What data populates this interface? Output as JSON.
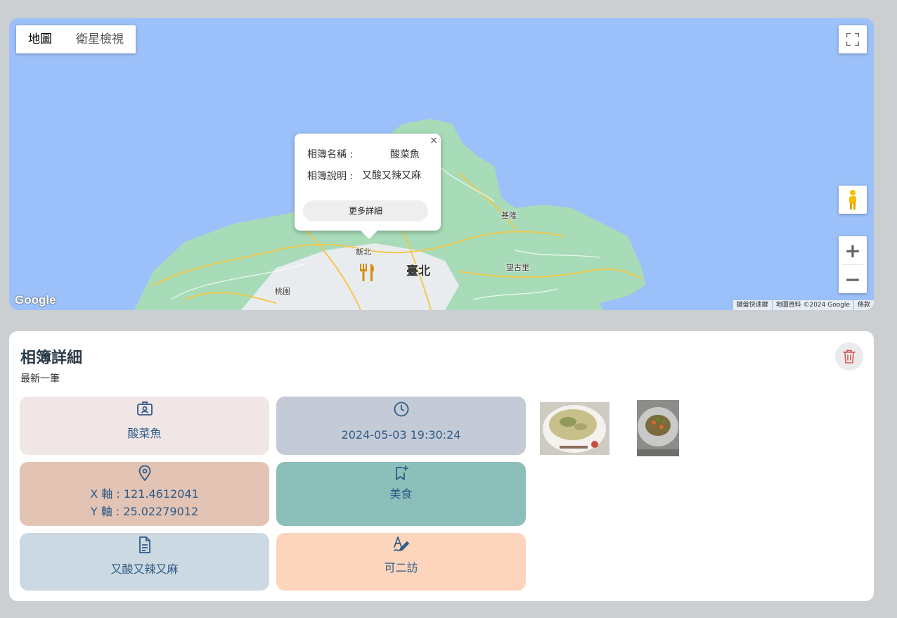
{
  "map": {
    "type_buttons": {
      "map": "地圖",
      "satellite": "衛星檢視"
    },
    "labels": {
      "taipei": "臺北",
      "new_taipei": "新北",
      "keelung": "基隆",
      "taoyuan": "桃園",
      "wangguli": "望古里"
    },
    "google_logo": "Google",
    "attribution": {
      "shortcuts": "鍵盤快速鍵",
      "data": "地圖資料 ©2024 Google",
      "terms": "條款"
    },
    "info_window": {
      "name_label": "相簿名稱 :",
      "name_value": "酸菜魚",
      "desc_label": "相簿說明 :",
      "desc_value": "又酸又辣又麻",
      "more_button": "更多詳細",
      "close": "×"
    }
  },
  "detail": {
    "title": "相簿詳細",
    "subtitle": "最新一筆",
    "name": "酸菜魚",
    "datetime": "2024-05-03 19:30:24",
    "x_coord": "X 軸 : 121.4612041",
    "y_coord": "Y 軸 : 25.02279012",
    "category": "美食",
    "description": "又酸又辣又麻",
    "author": "可二訪",
    "accent_color": "#2f5b87",
    "delete_icon_color": "#d9534f"
  }
}
